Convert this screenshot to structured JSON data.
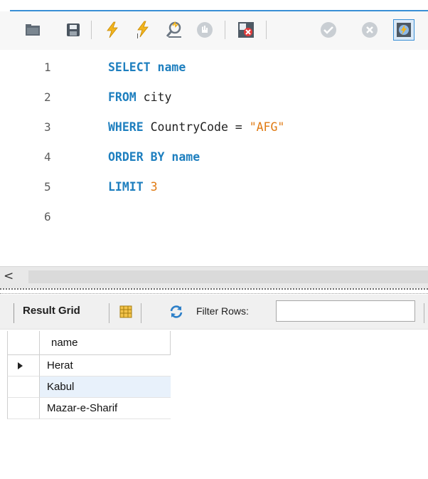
{
  "toolbar": {
    "icons": [
      "open-folder-icon",
      "save-icon",
      "execute-icon",
      "execute-current-icon",
      "explain-icon",
      "stop-icon",
      "toggle-error-icon",
      "commit-icon",
      "rollback-icon",
      "autocommit-icon"
    ]
  },
  "editor": {
    "lines": [
      {
        "num": "1",
        "tokens": [
          {
            "t": "SELECT name",
            "c": "kw"
          }
        ]
      },
      {
        "num": "2",
        "tokens": [
          {
            "t": "FROM",
            "c": "kw"
          },
          {
            "t": " city",
            "c": ""
          }
        ]
      },
      {
        "num": "3",
        "tokens": [
          {
            "t": "WHERE",
            "c": "kw"
          },
          {
            "t": " CountryCode = ",
            "c": ""
          },
          {
            "t": "\"AFG\"",
            "c": "str"
          }
        ]
      },
      {
        "num": "4",
        "tokens": [
          {
            "t": "ORDER BY name",
            "c": "kw"
          }
        ]
      },
      {
        "num": "5",
        "tokens": [
          {
            "t": "LIMIT",
            "c": "kw"
          },
          {
            "t": " ",
            "c": ""
          },
          {
            "t": "3",
            "c": "num"
          }
        ]
      },
      {
        "num": "6",
        "tokens": []
      }
    ]
  },
  "scroll": {
    "left_arrow": "<"
  },
  "results": {
    "label": "Result Grid",
    "filter_label": "Filter Rows:",
    "filter_value": "",
    "column": "name",
    "rows": [
      "Herat",
      "Kabul",
      "Mazar-e-Sharif"
    ],
    "selected_row": 0,
    "highlighted_row": 1
  },
  "colors": {
    "keyword": "#1e7fbf",
    "string": "#e07b14",
    "accent": "#3a8fd6"
  }
}
